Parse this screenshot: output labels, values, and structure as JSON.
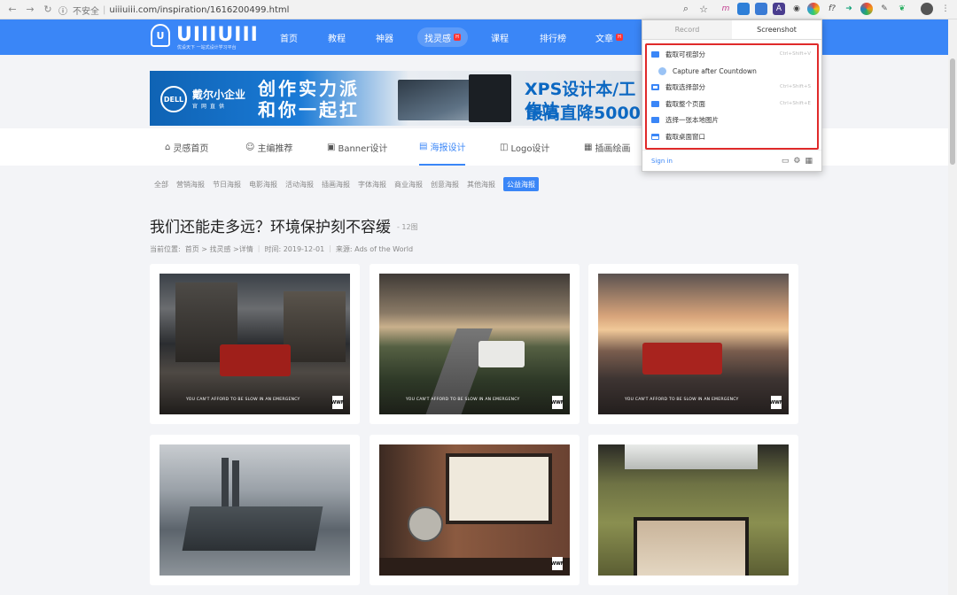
{
  "browser": {
    "url_insecure": "不安全",
    "url": "uiiiuiii.com/inspiration/1616200499.html"
  },
  "site": {
    "logo_text": "UIIIUIII",
    "logo_sub": "优设天下 一站式设计学习平台",
    "nav": [
      "首页",
      "教程",
      "神器",
      "找灵感",
      "课程",
      "排行榜",
      "文章"
    ],
    "hot_badge": "H"
  },
  "banner": {
    "brand": "DELL",
    "line1": "戴尔小企业",
    "line1_sub": "官网直供",
    "slogan1": "创作实力派",
    "slogan2": "和你一起扛",
    "product": "XPS设计本/工作站",
    "price": "最高直降5000"
  },
  "subnav": [
    "灵感首页",
    "主编推荐",
    "Banner设计",
    "海报设计",
    "Logo设计",
    "插画绘画"
  ],
  "tags": [
    "全部",
    "营销海报",
    "节日海报",
    "电影海报",
    "活动海报",
    "插画海报",
    "字体海报",
    "商业海报",
    "创意海报",
    "其他海报",
    "公益海报"
  ],
  "page": {
    "title": "我们还能走多远？环境保护刻不容缓",
    "count": "- 12图",
    "crumb_pos": "当前位置:",
    "crumb_path": "首页 > 找灵感 >详情",
    "crumb_time": "时间: 2019-12-01",
    "crumb_src": "来源: Ads of the World"
  },
  "poster": {
    "caption": "YOU CAN'T AFFORD TO BE SLOW IN AN EMERGENCY",
    "wwf": "WWF"
  },
  "popup": {
    "tab_record": "Record",
    "tab_screenshot": "Screenshot",
    "items": [
      {
        "label": "截取可视部分",
        "shortcut": "Ctrl+Shift+V"
      },
      {
        "label": "Capture after Countdown",
        "shortcut": ""
      },
      {
        "label": "截取选择部分",
        "shortcut": "Ctrl+Shift+S"
      },
      {
        "label": "截取整个页面",
        "shortcut": "Ctrl+Shift+E"
      },
      {
        "label": "选择一张本地图片",
        "shortcut": ""
      },
      {
        "label": "截取桌面窗口",
        "shortcut": ""
      }
    ],
    "signin": "Sign in"
  },
  "colors": {
    "brand": "#3a86f7",
    "highlight": "#e02a2a"
  }
}
